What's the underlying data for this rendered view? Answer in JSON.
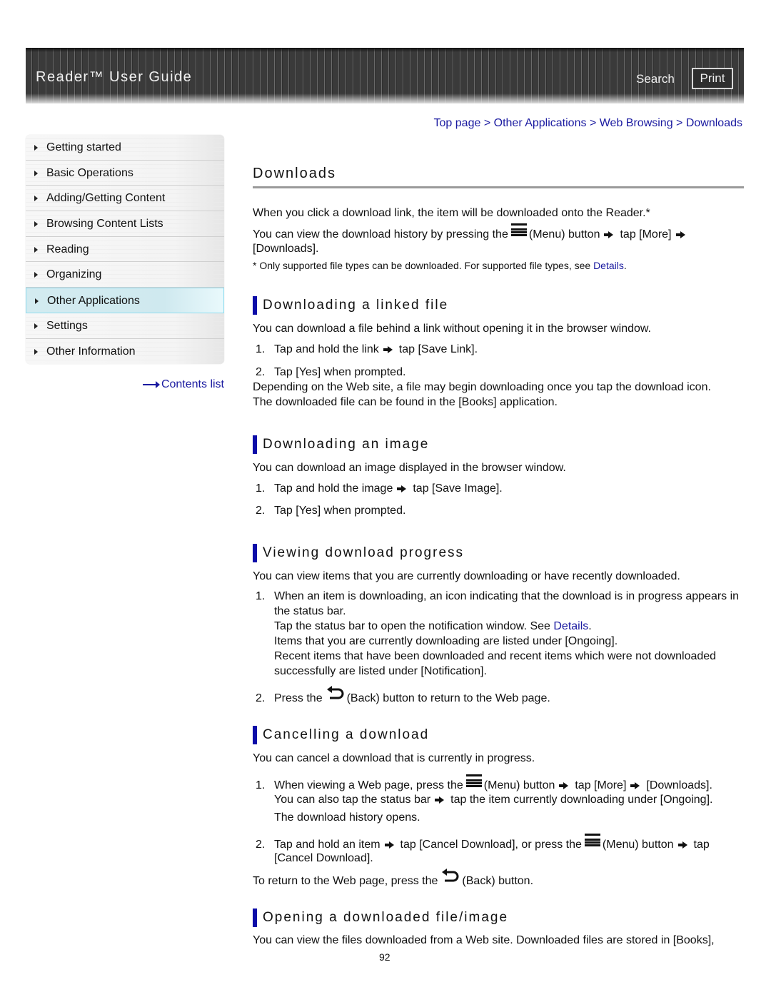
{
  "header": {
    "title": "Reader™ User Guide",
    "search_label": "Search",
    "print_label": "Print"
  },
  "breadcrumb": {
    "items": [
      "Top page",
      "Other Applications",
      "Web Browsing",
      "Downloads"
    ],
    "separator": ">"
  },
  "sidebar": {
    "items": [
      {
        "label": "Getting started",
        "active": false
      },
      {
        "label": "Basic Operations",
        "active": false
      },
      {
        "label": "Adding/Getting Content",
        "active": false
      },
      {
        "label": "Browsing Content Lists",
        "active": false
      },
      {
        "label": "Reading",
        "active": false
      },
      {
        "label": "Organizing",
        "active": false
      },
      {
        "label": "Other Applications",
        "active": true
      },
      {
        "label": "Settings",
        "active": false
      },
      {
        "label": "Other Information",
        "active": false
      }
    ],
    "contents_link": "Contents list"
  },
  "main": {
    "title": "Downloads",
    "intro": {
      "line1": "When you click a download link, the item will be downloaded onto the Reader.*",
      "line2_a": "You can view the download history by pressing the",
      "line2_b": "(Menu) button",
      "line2_c": "tap [More]",
      "line3": "[Downloads].",
      "note_a": "* Only supported file types can be downloaded. For supported file types, see ",
      "note_link": "Details",
      "note_b": "."
    },
    "sections": {
      "linked_file": {
        "heading": "Downloading a linked file",
        "desc": "You can download a file behind a link without opening it in the browser window.",
        "step1_num": "1.",
        "step1_a": "Tap and hold the link",
        "step1_b": "tap [Save Link].",
        "step2_num": "2.",
        "step2": "Tap [Yes] when prompted.",
        "after1": "Depending on the Web site, a file may begin downloading once you tap the download icon.",
        "after2": "The downloaded file can be found in the [Books] application."
      },
      "image": {
        "heading": "Downloading an image",
        "desc": "You can download an image displayed in the browser window.",
        "step1_num": "1.",
        "step1_a": "Tap and hold the image",
        "step1_b": "tap [Save Image].",
        "step2_num": "2.",
        "step2": "Tap [Yes] when prompted."
      },
      "progress": {
        "heading": "Viewing download progress",
        "desc": "You can view items that you are currently downloading or have recently downloaded.",
        "step1_num": "1.",
        "step1_l1": "When an item is downloading, an icon indicating that the download is in progress appears in",
        "step1_l2": "the status bar.",
        "step1_l3_a": "Tap the status bar to open the notification window. See ",
        "step1_l3_link": "Details",
        "step1_l3_b": ".",
        "step1_l4": "Items that you are currently downloading are listed under [Ongoing].",
        "step1_l5": "Recent items that have been downloaded and recent items which were not downloaded",
        "step1_l6": "successfully are listed under [Notification].",
        "step2_num": "2.",
        "step2_a": "Press the",
        "step2_b": "(Back) button to return to the Web page."
      },
      "cancel": {
        "heading": "Cancelling a download",
        "desc": "You can cancel a download that is currently in progress.",
        "step1_num": "1.",
        "step1_a": "When viewing a Web page, press the",
        "step1_b": "(Menu) button",
        "step1_c": "tap [More]",
        "step1_d": "[Downloads].",
        "step1_l2_a": "You can also tap the status bar",
        "step1_l2_b": "tap the item currently downloading under [Ongoing].",
        "step1_l3": "The download history opens.",
        "step2_num": "2.",
        "step2_a": "Tap and hold an item",
        "step2_b": "tap [Cancel Download], or press the",
        "step2_c": "(Menu) button",
        "step2_d": "tap",
        "step2_l2": "[Cancel Download].",
        "after_a": "To return to the Web page, press the",
        "after_b": "(Back) button."
      },
      "opening": {
        "heading": "Opening a downloaded file/image",
        "desc": "You can view the files downloaded from a Web site. Downloaded files are stored in [Books],"
      }
    }
  },
  "footer": {
    "page_number": "92"
  },
  "colors": {
    "link": "#1a1aa0",
    "heading_bar": "#0d0da8",
    "header_bg": "#3a3a3a",
    "active_nav": "#d3ebf0"
  }
}
